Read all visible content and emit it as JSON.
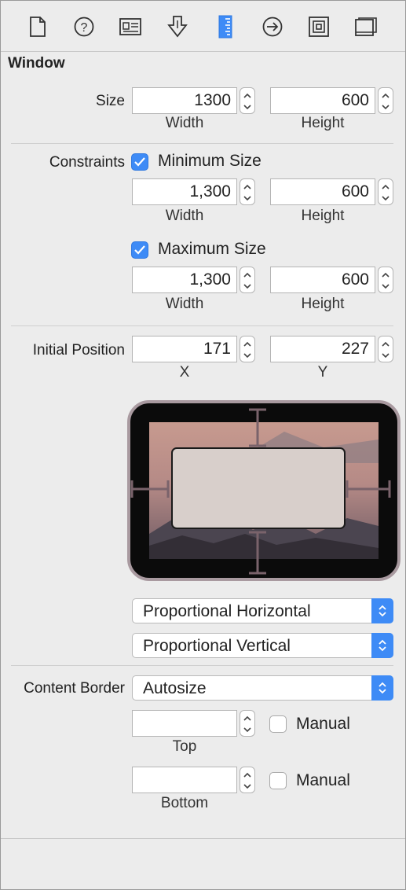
{
  "toolbar": {
    "icons": [
      "file-inspector-icon",
      "quick-help-icon",
      "identity-inspector-icon",
      "attributes-inspector-icon",
      "size-inspector-icon",
      "connections-inspector-icon",
      "bindings-inspector-icon",
      "view-effects-inspector-icon"
    ],
    "active": "size-inspector-icon",
    "accent": "#3e8bf6"
  },
  "window": {
    "section_title": "Window",
    "size": {
      "label": "Size",
      "width": "1300",
      "height": "600",
      "width_caption": "Width",
      "height_caption": "Height"
    },
    "constraints": {
      "label": "Constraints",
      "minimum": {
        "label": "Minimum Size",
        "checked": true,
        "width": "1,300",
        "height": "600",
        "width_caption": "Width",
        "height_caption": "Height"
      },
      "maximum": {
        "label": "Maximum Size",
        "checked": true,
        "width": "1,300",
        "height": "600",
        "width_caption": "Width",
        "height_caption": "Height"
      }
    },
    "initial_position": {
      "label": "Initial Position",
      "x": "171",
      "y": "227",
      "x_caption": "X",
      "y_caption": "Y",
      "horizontal_popup": "Proportional Horizontal",
      "vertical_popup": "Proportional Vertical"
    },
    "content_border": {
      "label": "Content Border",
      "popup": "Autosize",
      "top": {
        "value": "",
        "caption": "Top",
        "manual_label": "Manual",
        "manual_checked": false
      },
      "bottom": {
        "value": "",
        "caption": "Bottom",
        "manual_label": "Manual",
        "manual_checked": false
      }
    }
  }
}
